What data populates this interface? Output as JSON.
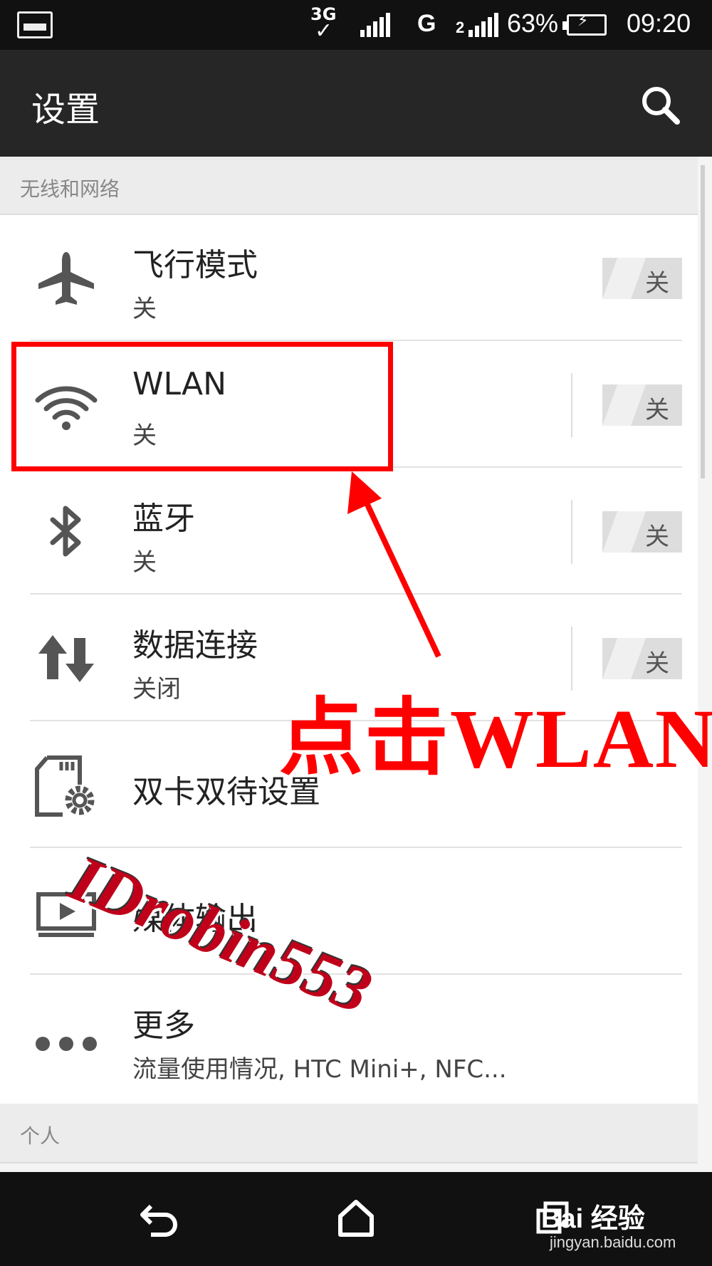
{
  "status_bar": {
    "network_3g": "3G",
    "network_g": "G",
    "sim2": "2",
    "battery_pct": "63%",
    "time": "09:20"
  },
  "header": {
    "title": "设置"
  },
  "sections": {
    "wireless": "无线和网络",
    "personal": "个人"
  },
  "items": [
    {
      "title": "飞行模式",
      "subtitle": "关",
      "toggle": "关",
      "icon": "airplane-icon"
    },
    {
      "title": "WLAN",
      "subtitle": "关",
      "toggle": "关",
      "icon": "wifi-icon"
    },
    {
      "title": "蓝牙",
      "subtitle": "关",
      "toggle": "关",
      "icon": "bluetooth-icon"
    },
    {
      "title": "数据连接",
      "subtitle": "关闭",
      "toggle": "关",
      "icon": "data-transfer-icon"
    },
    {
      "title": "双卡双待设置",
      "icon": "sim-settings-icon"
    },
    {
      "title": "媒体输出",
      "icon": "media-output-icon"
    },
    {
      "title": "更多",
      "subtitle": "流量使用情况, HTC Mini+, NFC...",
      "icon": "more-dots-icon"
    }
  ],
  "annotation": {
    "text": "点击WLAN",
    "color": "#ff0000"
  },
  "watermarks": {
    "author": "IDrobin553",
    "baidu_logo": "Bai 经验",
    "baidu_url": "jingyan.baidu.com"
  },
  "colors": {
    "status_bar": "#111111",
    "title_bar": "#262626",
    "annotation": "#ff0000"
  }
}
